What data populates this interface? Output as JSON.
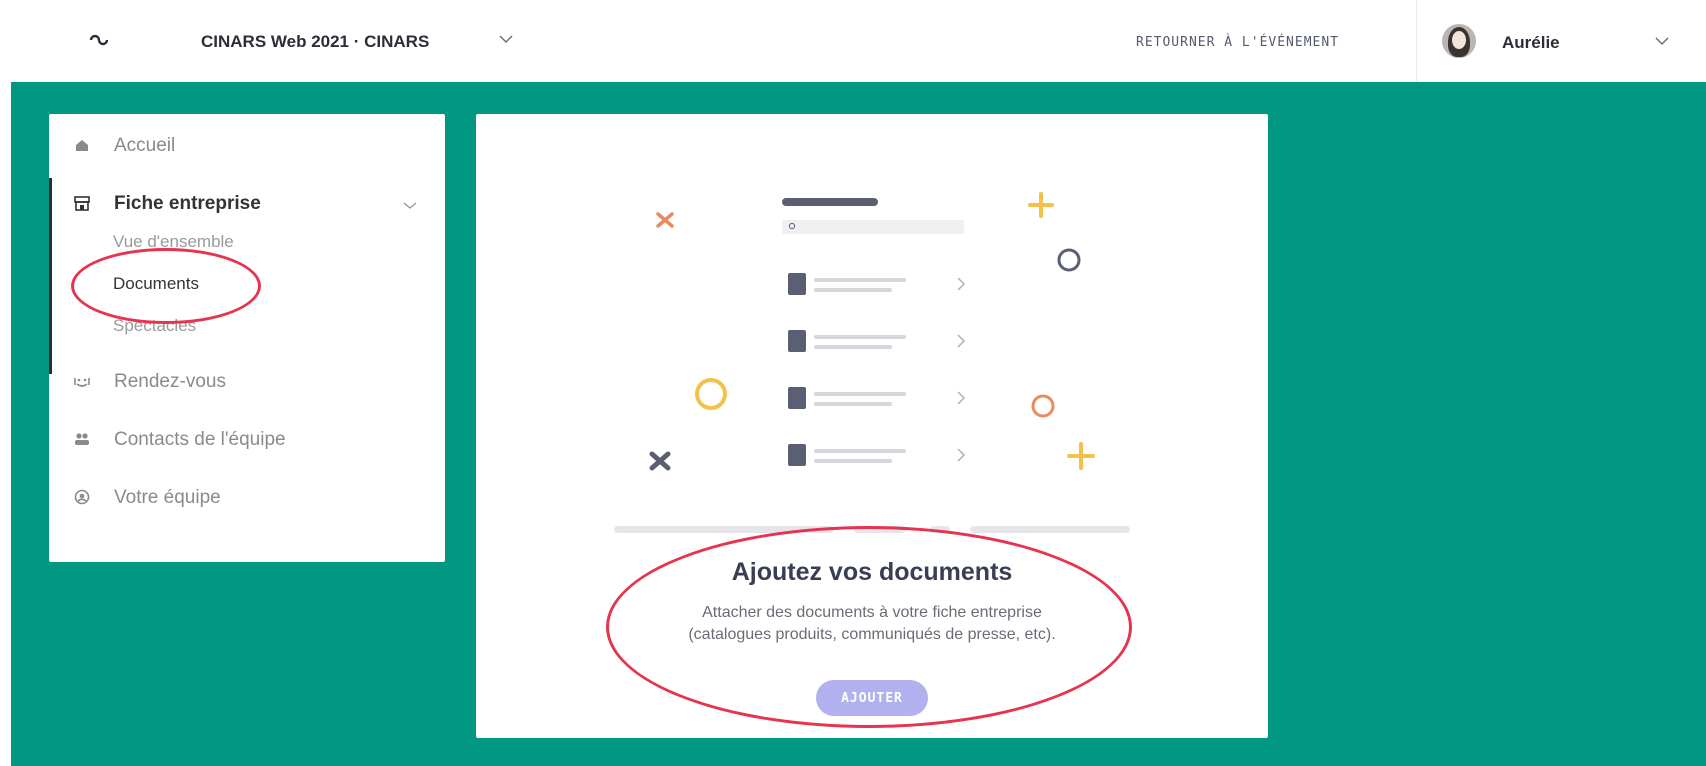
{
  "header": {
    "event_title": "CINARS Web 2021 · CINARS",
    "return_link": "RETOURNER À L'ÉVÉNEMENT",
    "user_name": "Aurélie"
  },
  "sidebar": {
    "items": [
      {
        "label": "Accueil",
        "icon": "home-icon"
      },
      {
        "label": "Fiche entreprise",
        "icon": "store-icon",
        "active": true
      },
      {
        "label": "Rendez-vous",
        "icon": "handshake-icon"
      },
      {
        "label": "Contacts de l'équipe",
        "icon": "people-icon"
      },
      {
        "label": "Votre équipe",
        "icon": "team-icon"
      }
    ],
    "subitems": [
      {
        "label": "Vue d'ensemble"
      },
      {
        "label": "Documents",
        "current": true
      },
      {
        "label": "Spectacles"
      }
    ]
  },
  "main": {
    "title": "Ajoutez vos documents",
    "description_line1": "Attacher des documents à votre fiche entreprise",
    "description_line2": "(catalogues produits, communiqués de presse, etc).",
    "add_button": "AJOUTER"
  },
  "colors": {
    "green_bg": "#009883",
    "annotation_red": "#e6334f",
    "button_purple": "#b3b0f0",
    "accent_yellow": "#f3c24a",
    "accent_orange": "#e98a5f"
  }
}
